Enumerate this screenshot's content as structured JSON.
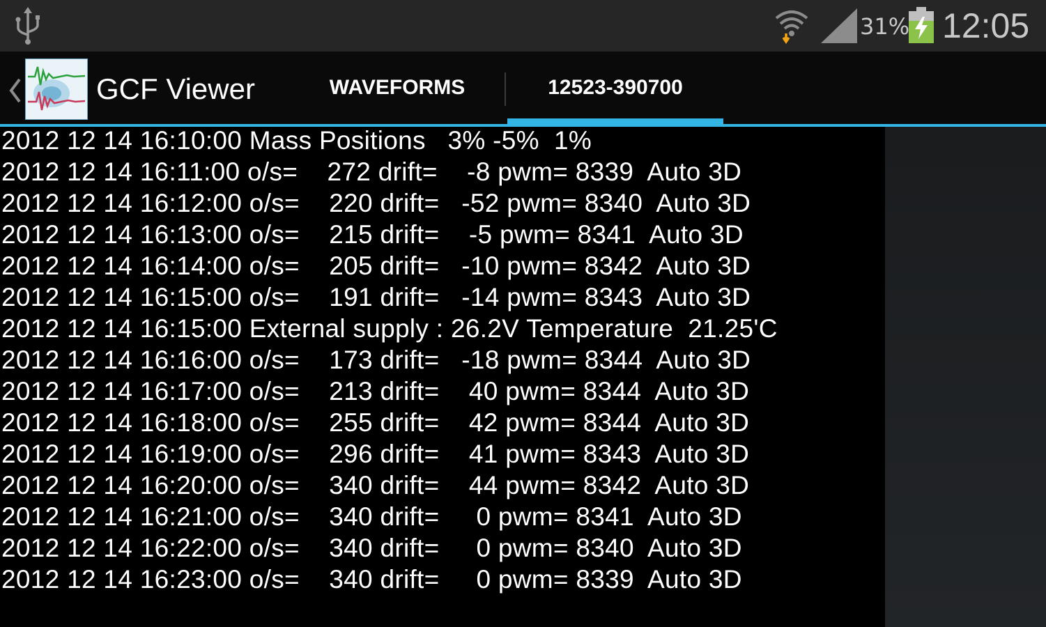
{
  "status_bar": {
    "battery_percent": "31%",
    "time": "12:05",
    "icons": [
      "usb-icon",
      "wifi-icon",
      "signal-icon",
      "battery-charging-icon"
    ]
  },
  "action_bar": {
    "app_title": "GCF Viewer",
    "tabs": [
      {
        "label": "WAVEFORMS",
        "selected": false
      },
      {
        "label": "12523-390700",
        "selected": true
      }
    ],
    "accent_color": "#33b5e5"
  },
  "log_lines": [
    "2012 12 14 16:10:00 Mass Positions   3% -5%  1%",
    "2012 12 14 16:11:00 o/s=    272 drift=    -8 pwm= 8339  Auto 3D",
    "2012 12 14 16:12:00 o/s=    220 drift=   -52 pwm= 8340  Auto 3D",
    "2012 12 14 16:13:00 o/s=    215 drift=    -5 pwm= 8341  Auto 3D",
    "2012 12 14 16:14:00 o/s=    205 drift=   -10 pwm= 8342  Auto 3D",
    "2012 12 14 16:15:00 o/s=    191 drift=   -14 pwm= 8343  Auto 3D",
    "2012 12 14 16:15:00 External supply : 26.2V Temperature  21.25'C",
    "2012 12 14 16:16:00 o/s=    173 drift=   -18 pwm= 8344  Auto 3D",
    "2012 12 14 16:17:00 o/s=    213 drift=    40 pwm= 8344  Auto 3D",
    "2012 12 14 16:18:00 o/s=    255 drift=    42 pwm= 8344  Auto 3D",
    "2012 12 14 16:19:00 o/s=    296 drift=    41 pwm= 8343  Auto 3D",
    "2012 12 14 16:20:00 o/s=    340 drift=    44 pwm= 8342  Auto 3D",
    "2012 12 14 16:21:00 o/s=    340 drift=     0 pwm= 8341  Auto 3D",
    "2012 12 14 16:22:00 o/s=    340 drift=     0 pwm= 8340  Auto 3D",
    "2012 12 14 16:23:00 o/s=    340 drift=     0 pwm= 8339  Auto 3D"
  ]
}
